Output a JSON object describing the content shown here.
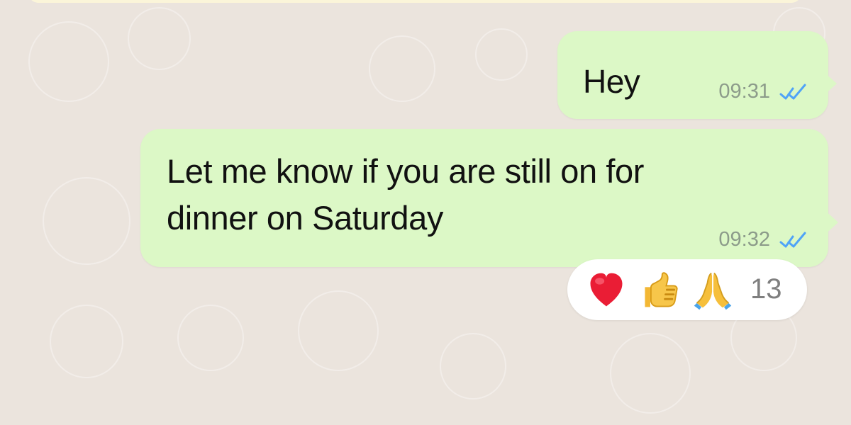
{
  "chat": {
    "messages": [
      {
        "text": "Hey",
        "time": "09:31"
      },
      {
        "text_line_1": "Let me know if you are still on for",
        "text_line_2": "dinner on Saturday",
        "time": "09:32"
      }
    ],
    "reaction": {
      "count": "13",
      "icons": [
        "heart-icon",
        "thumbs-up-icon",
        "praying-hands-icon"
      ]
    }
  },
  "colors": {
    "bubble": "#dcf8c6",
    "background": "#ebe4dd",
    "checks": "#4fa3f7",
    "time": "#8c9b8a",
    "reaction_pill": "#ffffff"
  }
}
